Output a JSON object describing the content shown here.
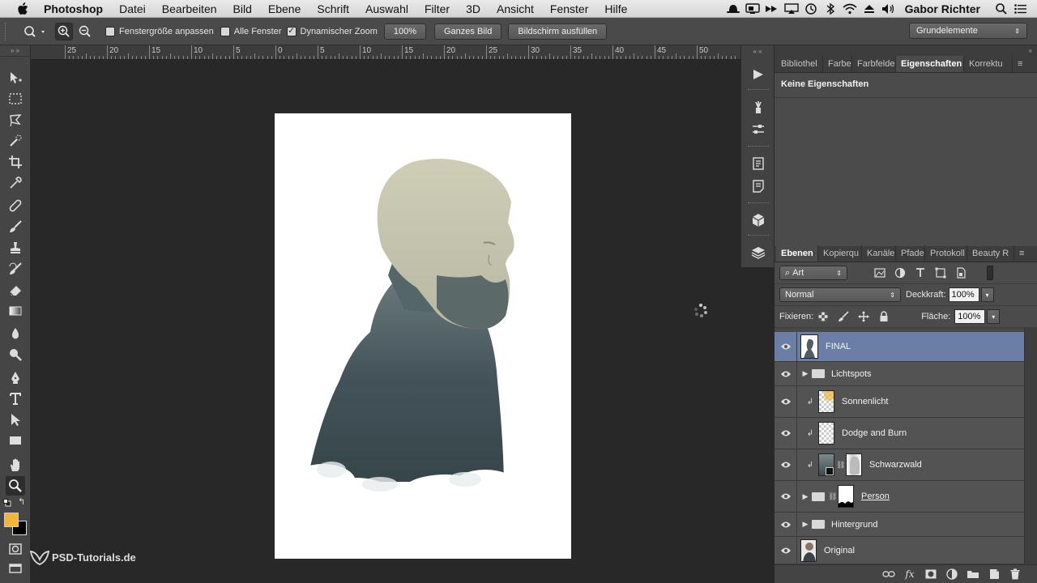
{
  "menubar": {
    "app_name": "Photoshop",
    "items": [
      "Datei",
      "Bearbeiten",
      "Bild",
      "Ebene",
      "Schrift",
      "Auswahl",
      "Filter",
      "3D",
      "Ansicht",
      "Fenster",
      "Hilfe"
    ],
    "user": "Gabor Richter"
  },
  "options_bar": {
    "resize_windows_label": "Fenstergröße anpassen",
    "resize_windows_checked": false,
    "all_windows_label": "Alle Fenster",
    "all_windows_checked": false,
    "scrubby_zoom_label": "Dynamischer Zoom",
    "scrubby_zoom_checked": true,
    "zoom_100_label": "100%",
    "fit_screen_label": "Ganzes Bild",
    "fill_screen_label": "Bildschirm ausfüllen",
    "workspace": "Grundelemente"
  },
  "ruler": {
    "labels": [
      "25",
      "20",
      "15",
      "10",
      "5",
      "0",
      "5",
      "10",
      "15",
      "20",
      "25",
      "30",
      "35",
      "40",
      "45",
      "50"
    ]
  },
  "properties_panel": {
    "tabs": [
      "Bibliothel",
      "Farbe",
      "Farbfelde",
      "Eigenschaften",
      "Korrektu"
    ],
    "active_tab": "Eigenschaften",
    "message": "Keine Eigenschaften"
  },
  "layers_panel": {
    "tabs": [
      "Ebenen",
      "Kopierqu",
      "Kanäle",
      "Pfade",
      "Protokoll",
      "Beauty R"
    ],
    "active_tab": "Ebenen",
    "filter_kind": "Art",
    "blend_mode": "Normal",
    "opacity_label": "Deckkraft:",
    "opacity": "100%",
    "lock_label": "Fixieren:",
    "fill_label": "Fläche:",
    "fill": "100%",
    "layers": [
      {
        "name": "FINAL",
        "type": "layer",
        "selected": true
      },
      {
        "name": "Lichtspots",
        "type": "group"
      },
      {
        "name": "Sonnenlicht",
        "type": "clipped"
      },
      {
        "name": "Dodge and Burn",
        "type": "clipped"
      },
      {
        "name": "Schwarzwald",
        "type": "clipped-masked"
      },
      {
        "name": "Person",
        "type": "group-masked"
      },
      {
        "name": "Hintergrund",
        "type": "group"
      },
      {
        "name": "Original",
        "type": "layer"
      }
    ]
  },
  "colors": {
    "foreground": "#f2b53c",
    "background": "#000000",
    "selected_layer": "#6b7fa6"
  },
  "watermark": "PSD-Tutorials.de"
}
